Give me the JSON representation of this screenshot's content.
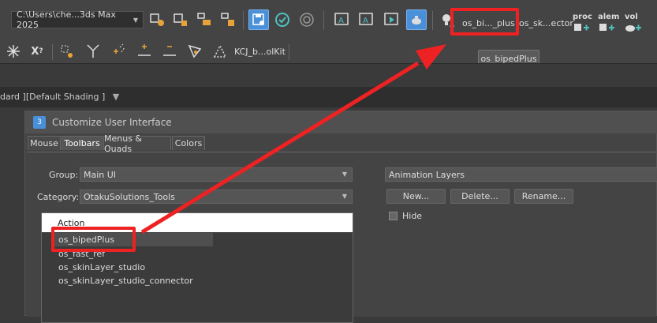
{
  "main_toolbar": {
    "path_dropdown": "C:\\Users\\che...3ds Max 2025",
    "os_biped_label": "os_bi..._plus",
    "os_skin_label": "os_sk...ector",
    "proc_label": "proc",
    "alem_label": "alem",
    "vol_label": "vol",
    "tooltip": "os_bipedPlus"
  },
  "second_toolbar": {
    "kcj_label": "KCJ_b...olKit"
  },
  "viewport": {
    "label": "dard ][Default Shading ]"
  },
  "dialog": {
    "title": "Customize User Interface",
    "tabs": [
      "Mouse",
      "Toolbars",
      "Menus & Quads",
      "Colors"
    ],
    "active_tab": "Toolbars",
    "group_label": "Group:",
    "group_value": "Main UI",
    "category_label": "Category:",
    "category_value": "OtakuSolutions_Tools",
    "list_header": "Action",
    "list_items": [
      "os_bipedPlus",
      "os_fast_ref",
      "os_skinLayer_studio",
      "os_skinLayer_studio_connector"
    ],
    "toolbar_dropdown": "Animation Layers",
    "new_button": "New...",
    "delete_button": "Delete...",
    "rename_button": "Rename...",
    "hide_label": "Hide"
  },
  "colors": {
    "highlight": "#e22222",
    "accent_blue": "#4a90d9"
  }
}
